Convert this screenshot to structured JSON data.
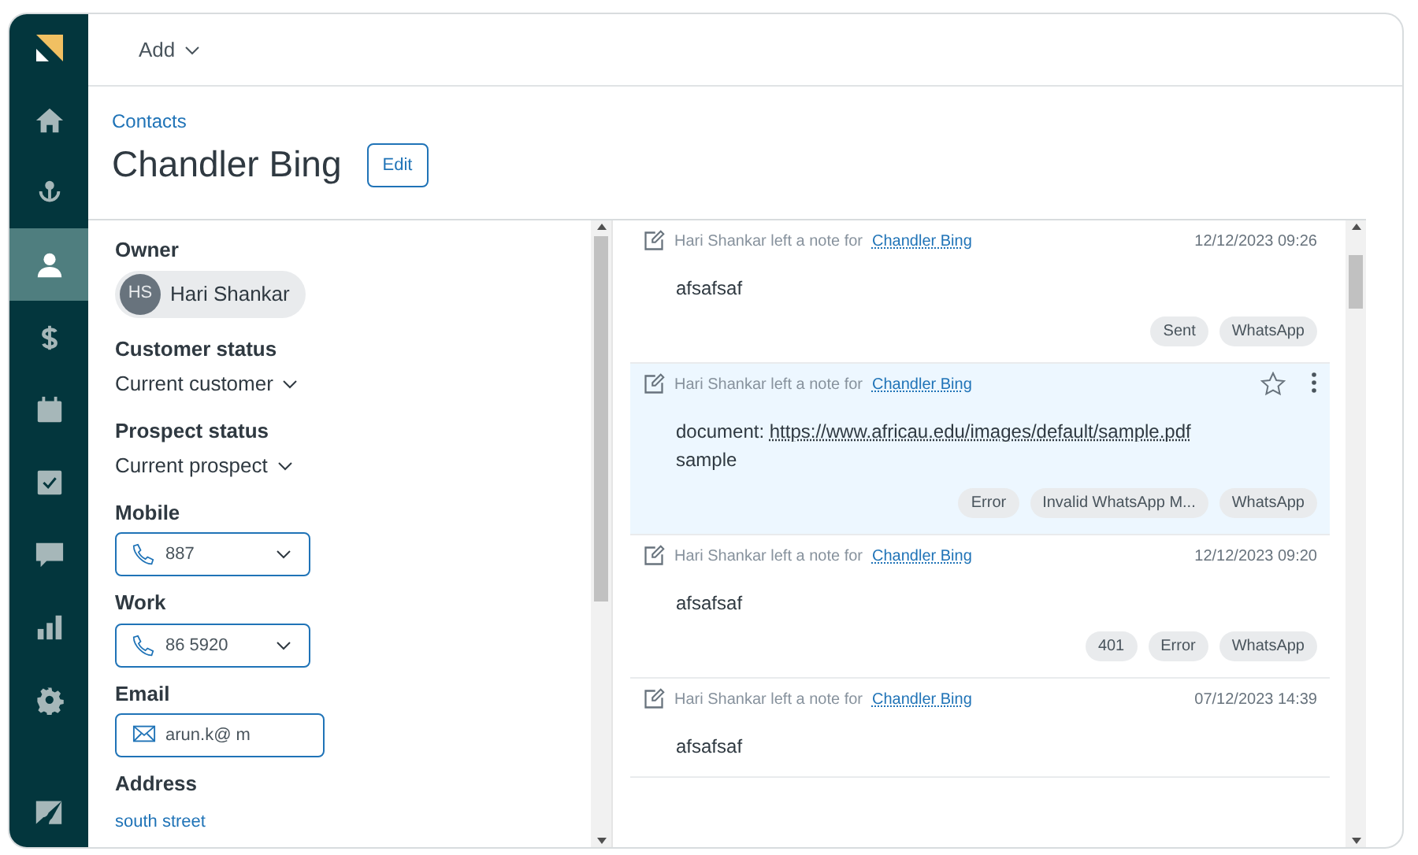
{
  "sidebar": {
    "items": [
      {
        "kind": "home",
        "selected": false
      },
      {
        "kind": "leads",
        "selected": false
      },
      {
        "kind": "contacts",
        "selected": true
      },
      {
        "kind": "deals",
        "selected": false
      },
      {
        "kind": "calendar",
        "selected": false
      },
      {
        "kind": "tasks",
        "selected": false
      },
      {
        "kind": "chat",
        "selected": false
      },
      {
        "kind": "reports",
        "selected": false
      },
      {
        "kind": "settings",
        "selected": false
      }
    ]
  },
  "topbar": {
    "add_menu": "Add"
  },
  "breadcrumb": "Contacts",
  "title": "Chandler Bing",
  "edit_button": "Edit",
  "details": [
    {
      "kind": "owner",
      "label": "Owner",
      "initials": "HS",
      "value": "Hari Shankar"
    },
    {
      "kind": "dropdown",
      "label": "Customer status",
      "value": "Current customer"
    },
    {
      "kind": "dropdown",
      "label": "Prospect status",
      "value": "Current prospect"
    },
    {
      "kind": "phone",
      "label": "Mobile",
      "value": "887"
    },
    {
      "kind": "phone",
      "label": "Work",
      "value": "86 5920"
    },
    {
      "kind": "email",
      "label": "Email",
      "value": "arun.k@ m"
    },
    {
      "kind": "link",
      "label": "Address",
      "value": "south street"
    }
  ],
  "notes": [
    {
      "author": "Hari Shankar left a note for ",
      "contact": "Chandler Bing",
      "date": "12/12/2023 09:26",
      "highlighted": false,
      "body": [
        "afsafsaf"
      ],
      "tags": [
        "Sent",
        "WhatsApp"
      ]
    },
    {
      "author": "Hari Shankar left a note for ",
      "contact": "Chandler Bing",
      "highlighted": true,
      "body_prefix": "document: ",
      "body_link": "https://www.africau.edu/images/default/sample.pdf",
      "body": [
        "sample"
      ],
      "tags": [
        "Error",
        "Invalid WhatsApp M...",
        "WhatsApp"
      ]
    },
    {
      "author": "Hari Shankar left a note for ",
      "contact": "Chandler Bing",
      "date": "12/12/2023 09:20",
      "highlighted": false,
      "body": [
        "afsafsaf"
      ],
      "tags": [
        "401",
        "Error",
        "WhatsApp"
      ]
    },
    {
      "author": "Hari Shankar left a note for ",
      "contact": "Chandler Bing",
      "date": "07/12/2023 14:39",
      "highlighted": false,
      "body": [
        "afsafsaf"
      ]
    }
  ]
}
